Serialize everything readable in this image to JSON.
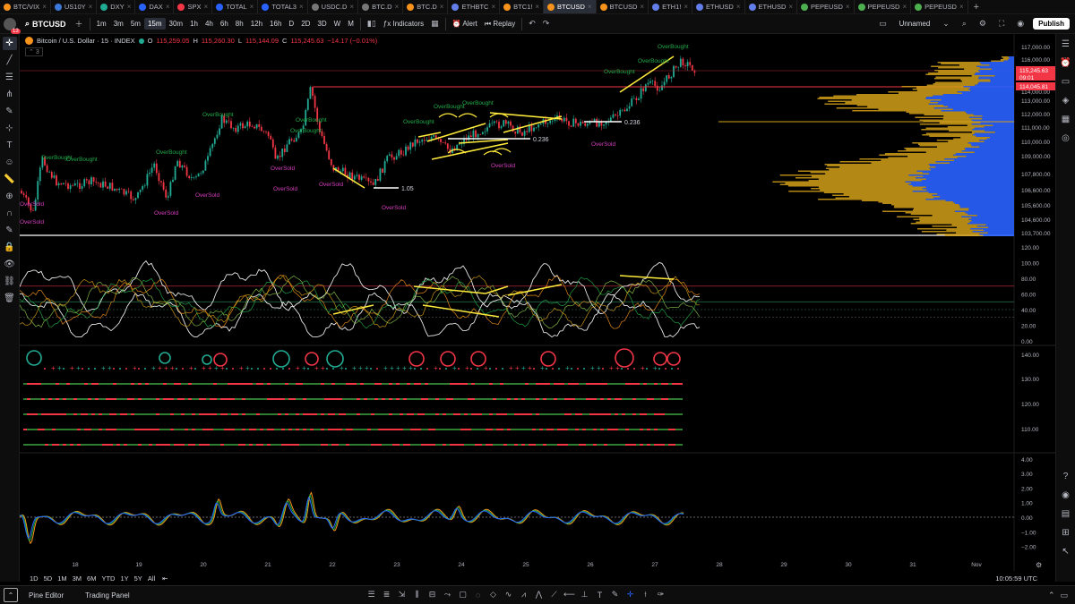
{
  "tabs": [
    {
      "label": "BTC/VIX",
      "color": "#f7931a"
    },
    {
      "label": "US10Y",
      "color": "#3c78d8"
    },
    {
      "label": "DXY",
      "color": "#22ab94"
    },
    {
      "label": "DAX",
      "color": "#2962ff"
    },
    {
      "label": "SPX",
      "color": "#f23645"
    },
    {
      "label": "TOTAL",
      "color": "#2962ff"
    },
    {
      "label": "TOTAL3",
      "color": "#2962ff"
    },
    {
      "label": "USDC.D",
      "color": "#777777"
    },
    {
      "label": "BTC.D",
      "color": "#777777"
    },
    {
      "label": "BTC.D",
      "color": "#f7931a"
    },
    {
      "label": "ETHBTC",
      "color": "#627eea"
    },
    {
      "label": "BTC1!",
      "color": "#f7931a"
    },
    {
      "label": "BTCUSD",
      "color": "#f7931a",
      "active": true
    },
    {
      "label": "BTCUSD",
      "color": "#f7931a"
    },
    {
      "label": "ETH1!",
      "color": "#627eea"
    },
    {
      "label": "ETHUSD",
      "color": "#627eea"
    },
    {
      "label": "ETHUSD",
      "color": "#627eea"
    },
    {
      "label": "PEPEUSD",
      "color": "#4caf50"
    },
    {
      "label": "PEPEUSD",
      "color": "#4caf50"
    },
    {
      "label": "PEPEUSD",
      "color": "#4caf50"
    }
  ],
  "toolbar": {
    "notif_count": "13",
    "symbol": "BTCUSD",
    "intervals": [
      "1m",
      "3m",
      "5m",
      "15m",
      "30m",
      "1h",
      "4h",
      "6h",
      "8h",
      "12h",
      "16h",
      "D",
      "2D",
      "3D",
      "W",
      "M"
    ],
    "selected_interval": "15m",
    "indicators": "Indicators",
    "alert": "Alert",
    "replay": "Replay",
    "layout_name": "Unnamed",
    "publish": "Publish"
  },
  "legend": {
    "title": "Bitcoin / U.S. Dollar · 15 · INDEX",
    "o_label": "O",
    "o": "115,259.05",
    "h_label": "H",
    "h": "115,260.30",
    "l_label": "L",
    "l": "115,144.09",
    "c_label": "C",
    "c": "115,245.63",
    "change": "−14.17 (−0.01%)",
    "indicator_count": "3"
  },
  "price_axis": {
    "labels": [
      "117,000.00",
      "116,000.00",
      "114,000.00",
      "113,000.00",
      "112,000.00",
      "111,000.00",
      "110,000.00",
      "109,000.00",
      "107,800.00",
      "106,600.00",
      "105,600.00",
      "104,600.00",
      "103,700.00"
    ],
    "current_price": "115,245.63",
    "countdown": "09:01",
    "red_line_price": "114,045.81"
  },
  "osc_axis": {
    "labels": [
      "120.00",
      "100.00",
      "80.00",
      "60.00",
      "40.00",
      "20.00",
      "0.00"
    ]
  },
  "pane3_axis": {
    "labels": [
      "140.00",
      "130.00",
      "120.00",
      "110.00"
    ]
  },
  "pane4_axis": {
    "labels": [
      "4.00",
      "3.00",
      "2.00",
      "1.00",
      "0.00",
      "−1.00",
      "−2.00"
    ]
  },
  "time_axis": {
    "labels": [
      "18",
      "19",
      "20",
      "21",
      "22",
      "23",
      "24",
      "25",
      "26",
      "27",
      "28",
      "29",
      "30",
      "31",
      "Nov"
    ]
  },
  "annotations": {
    "overbought": "OverBought",
    "oversold": "OverSold",
    "fib_1": "1.05",
    "fib_2": "0.236",
    "fib_3": "0.236"
  },
  "ranges": [
    "1D",
    "5D",
    "1M",
    "3M",
    "6M",
    "YTD",
    "1Y",
    "5Y",
    "All"
  ],
  "clock": "10:05:59 UTC",
  "bottom": {
    "pine": "Pine Editor",
    "trading": "Trading Panel"
  },
  "colors": {
    "up": "#22ab94",
    "down": "#f23645",
    "vp_up": "#2962ff",
    "vp_down": "#d4a017",
    "trend": "#ffeb3b"
  }
}
